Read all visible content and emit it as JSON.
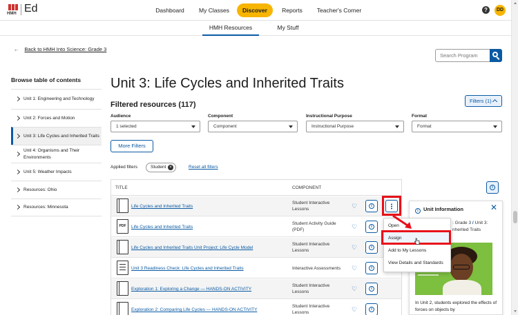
{
  "brand": {
    "logo_text": "HMH",
    "product": "Ed"
  },
  "nav": {
    "items": [
      {
        "label": "Dashboard"
      },
      {
        "label": "My Classes"
      },
      {
        "label": "Discover"
      },
      {
        "label": "Reports"
      },
      {
        "label": "Teacher's Corner"
      }
    ],
    "active": "Discover",
    "help_glyph": "?",
    "avatar_initials": "DD"
  },
  "subtabs": [
    {
      "label": "HMH Resources"
    },
    {
      "label": "My Stuff"
    }
  ],
  "back_link": {
    "arrow": "←",
    "label": "Back to HMH Into Science: Grade 3"
  },
  "search": {
    "placeholder": "Search Program"
  },
  "toc": {
    "heading": "Browse table of contents",
    "items": [
      {
        "label": "Unit 1: Engineering and Technology"
      },
      {
        "label": "Unit 2: Forces and Motion"
      },
      {
        "label": "Unit 3: Life Cycles and Inherited Traits"
      },
      {
        "label": "Unit 4: Organisms and Their Environments"
      },
      {
        "label": "Unit 5: Weather Impacts"
      },
      {
        "label": "Resources: Ohio"
      },
      {
        "label": "Resources: Minnesota"
      }
    ]
  },
  "main": {
    "title": "Unit 3: Life Cycles and Inherited Traits",
    "filtered_title": "Filtered resources (117)",
    "filters_button": "Filters (1)",
    "filters": [
      {
        "label": "Audience",
        "value": "1 selected"
      },
      {
        "label": "Component",
        "value": "Component"
      },
      {
        "label": "Instructional Purpose",
        "value": "Instructional Purpose"
      },
      {
        "label": "Format",
        "value": "Format"
      }
    ],
    "more_filters": "More Filters",
    "applied_label": "Applied filters",
    "chip": "Student",
    "chip_close": "×",
    "reset_link": "Reset all filters"
  },
  "table": {
    "headers": {
      "title": "TITLE",
      "component": "COMPONENT"
    },
    "rows": [
      {
        "icon": "book-icon",
        "icon_text": "",
        "title": "Life Cycles and Inherited Traits",
        "component": "Student Interactive Lessons"
      },
      {
        "icon": "pdf-icon",
        "icon_text": "PDF",
        "title": "Life Cycles and Inherited Traits",
        "component": "Student Activity Guide (PDF)"
      },
      {
        "icon": "book-icon",
        "icon_text": "",
        "title": "Life Cycles and Inherited Traits Unit Project: Life Cycle Model",
        "component": "Student Interactive Lessons"
      },
      {
        "icon": "checklist-icon",
        "icon_text": "",
        "title": "Unit 3 Readiness Check: Life Cycles and Inherited Traits",
        "component": "Interactive Assessments"
      },
      {
        "icon": "book-icon",
        "icon_text": "",
        "title": "Exploration 1: Exploring a Change — HANDS-ON ACTIVITY",
        "component": "Student Interactive Lessons"
      },
      {
        "icon": "book-icon",
        "icon_text": "",
        "title": "Exploration 2: Comparing Life Cycles — HANDS-ON ACTIVITY",
        "component": "Student Interactive Lessons"
      }
    ],
    "heart_glyph": "♡",
    "info_glyph": "i"
  },
  "context_menu": {
    "items": [
      {
        "label": "Open"
      },
      {
        "label": "Assign"
      },
      {
        "label": "Add to My Lessons"
      },
      {
        "label": "View Details and Standards"
      }
    ]
  },
  "unit_panel": {
    "heading": "Unit Information",
    "icon_glyph": "i",
    "close_glyph": "✕",
    "crumb_line1_a": ": Grade 3",
    "crumb_sep": "/",
    "crumb_line1_b": "Unit 3:",
    "crumb_line2": "nherited Traits",
    "body": "In Unit 2, students explored the effects of forces on objects by"
  },
  "colors": {
    "accent": "#0a5aa3",
    "nav_active": "#f7b500",
    "highlight": "#e8101a"
  }
}
